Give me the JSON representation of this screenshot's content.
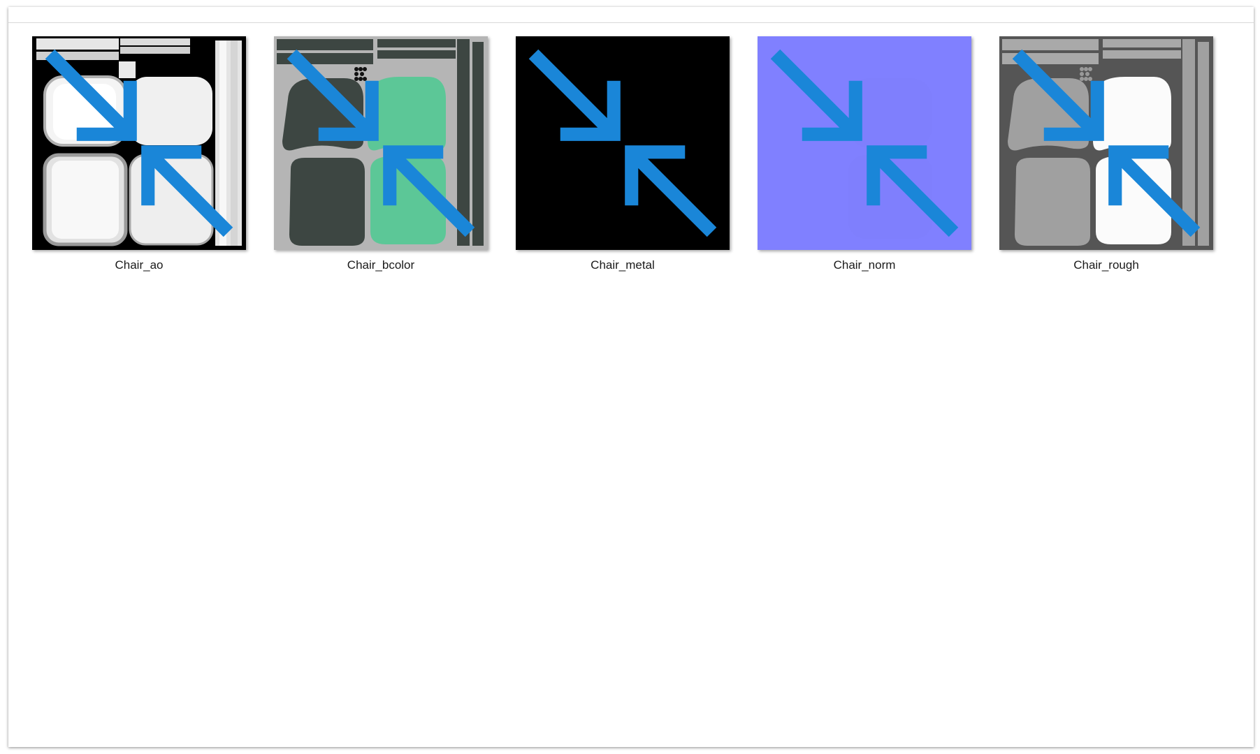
{
  "files": [
    {
      "name": "Chair_ao",
      "icon": "compressed-icon"
    },
    {
      "name": "Chair_bcolor",
      "icon": "compressed-icon"
    },
    {
      "name": "Chair_metal",
      "icon": "compressed-icon"
    },
    {
      "name": "Chair_norm",
      "icon": "compressed-icon"
    },
    {
      "name": "Chair_rough",
      "icon": "compressed-icon"
    }
  ],
  "colors": {
    "badge": "#1a86d8",
    "ao_bg": "#000000",
    "bcolor_bg": "#b5b5b5",
    "bcolor_dark": "#3d4642",
    "bcolor_green": "#5cc797",
    "metal_bg": "#000000",
    "norm_bg": "#8080ff",
    "rough_bg": "#555555"
  }
}
